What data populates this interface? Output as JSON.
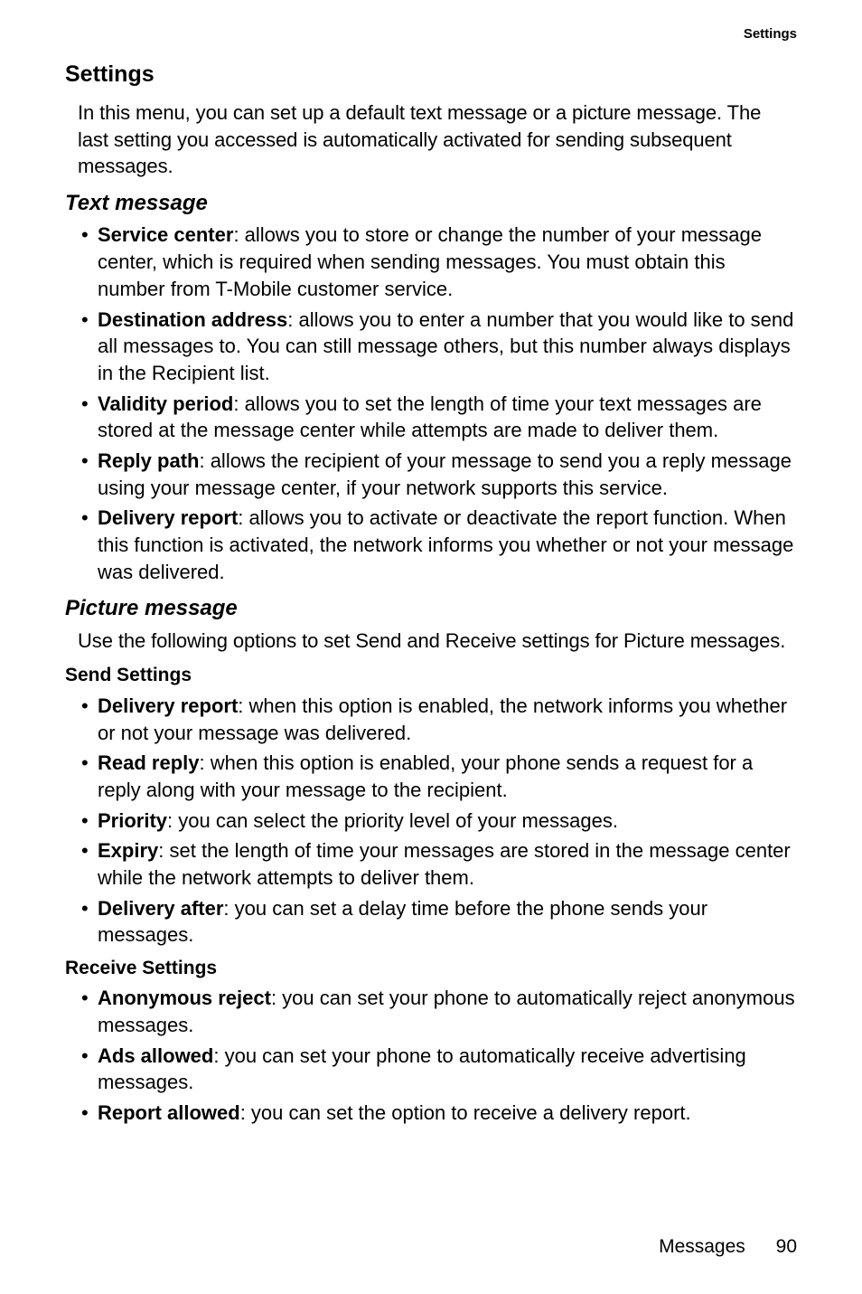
{
  "running_head": "Settings",
  "h1": "Settings",
  "intro": "In this menu, you can set up a default text message or a picture message. The last setting you accessed is automatically activated for sending subsequent messages.",
  "text_msg": {
    "heading": "Text message",
    "items": [
      {
        "term": "Service center",
        "desc": ": allows you to store or change the number of your message center, which is required when sending messages. You must obtain this number from T-Mobile customer service."
      },
      {
        "term": "Destination address",
        "desc": ": allows you to enter a number that you would like to send all messages to. You can still message others, but this number always displays in the Recipient list."
      },
      {
        "term": "Validity period",
        "desc": ": allows you to set the length of time your text messages are stored at the message center while attempts are made to deliver them."
      },
      {
        "term": "Reply path",
        "desc": ": allows the recipient of your message to send you a reply message using your message center, if your network supports this service."
      },
      {
        "term": "Delivery report",
        "desc": ": allows you to activate or deactivate the report function. When this function is activated, the network informs you whether or not your message was delivered."
      }
    ]
  },
  "pic_msg": {
    "heading": "Picture message",
    "intro": "Use the following options to set Send and Receive settings for Picture messages.",
    "send_heading": "Send Settings",
    "send_items": [
      {
        "term": "Delivery report",
        "desc": ": when this option is enabled, the network informs you whether or not your message was delivered."
      },
      {
        "term": "Read reply",
        "desc": ": when this option is enabled, your phone sends a request for a reply along with your message to the recipient."
      },
      {
        "term": "Priority",
        "desc": ": you can select the priority level of your messages."
      },
      {
        "term": "Expiry",
        "desc": ": set the length of time your messages are stored in the message center while the network attempts to deliver them."
      },
      {
        "term": "Delivery after",
        "desc": ": you can set a delay time before the phone sends your messages."
      }
    ],
    "recv_heading": "Receive Settings",
    "recv_items": [
      {
        "term": "Anonymous reject",
        "desc": ": you can set your phone to automatically reject anonymous messages."
      },
      {
        "term": "Ads allowed",
        "desc": ": you can set your phone to automatically receive advertising messages."
      },
      {
        "term": "Report allowed",
        "desc": ": you can set the option to receive a delivery report."
      }
    ]
  },
  "footer": {
    "section": "Messages",
    "page": "90"
  }
}
